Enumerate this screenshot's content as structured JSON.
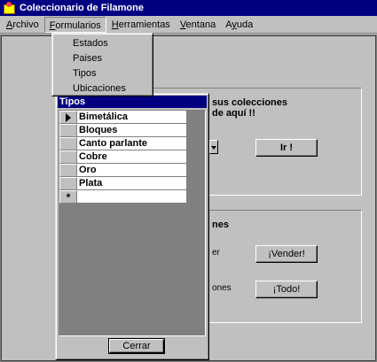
{
  "window": {
    "title": "Coleccionario de  Filamone"
  },
  "menubar": {
    "items": [
      {
        "label": "Archivo",
        "mnemonic": "A",
        "rest": "rchivo"
      },
      {
        "label": "Formularios",
        "mnemonic": "F",
        "rest": "ormularios"
      },
      {
        "label": "Herramientas",
        "mnemonic": "H",
        "rest": "erramientas"
      },
      {
        "label": "Ventana",
        "mnemonic": "V",
        "rest": "entana"
      },
      {
        "label": "Ayuda",
        "mnemonic": "y",
        "pre": "A",
        "rest": "uda"
      }
    ]
  },
  "dropdown": {
    "items": [
      "Estados",
      "Paises",
      "Tipos",
      "Ubicaciones"
    ]
  },
  "panel_top": {
    "line1": "sus colecciones",
    "line2": "de aquí !!",
    "go_button": "Ir !"
  },
  "panel_bottom": {
    "heading": "nes",
    "label1": "er",
    "label2": "ones",
    "sell_button": "¡Vender!",
    "all_button": "¡Todo!"
  },
  "tipos_window": {
    "title": "Tipos",
    "rows": [
      "Bimetálica",
      "Bloques",
      "Canto parlante",
      "Cobre",
      "Oro",
      "Plata"
    ],
    "new_row_marker": "*",
    "close_button": "Cerrar"
  },
  "colors": {
    "titlebar": "#000080",
    "face": "#c0c0c0",
    "workspace": "#808080"
  }
}
